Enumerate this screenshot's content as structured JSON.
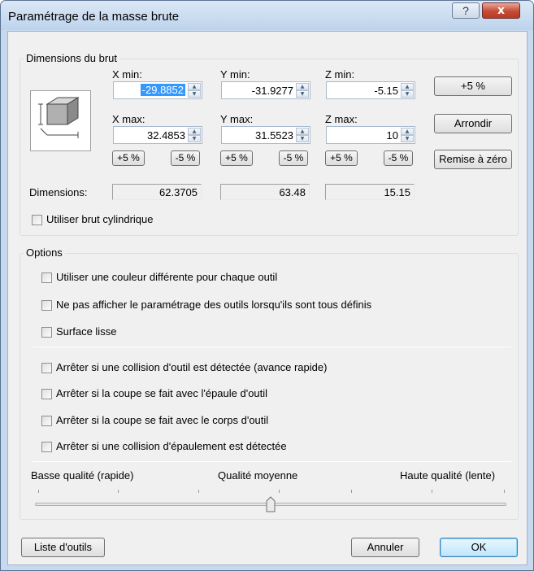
{
  "window": {
    "title": "Paramétrage de la masse brute",
    "help_glyph": "?",
    "close_glyph": "x"
  },
  "dimensions_group": {
    "legend": "Dimensions du brut",
    "x_min_label": "X min:",
    "y_min_label": "Y min:",
    "z_min_label": "Z min:",
    "x_max_label": "X max:",
    "y_max_label": "Y max:",
    "z_max_label": "Z max:",
    "x_min": "-29.8852",
    "y_min": "-31.9277",
    "z_min": "-5.15",
    "x_max": "32.4853",
    "y_max": "31.5523",
    "z_max": "10",
    "plus5": "+5 %",
    "minus5": "-5 %",
    "dimensions_label": "Dimensions:",
    "dim_x": "62.3705",
    "dim_y": "63.48",
    "dim_z": "15.15",
    "cylinder_label": "Utiliser brut cylindrique",
    "cylinder_checked": false,
    "btn_plus5": "+5 %",
    "btn_round": "Arrondir",
    "btn_reset": "Remise à zéro"
  },
  "options_group": {
    "legend": "Options",
    "items": [
      {
        "label": "Utiliser une couleur différente pour chaque outil",
        "checked": false
      },
      {
        "label": "Ne pas afficher le paramétrage des outils lorsqu'ils sont tous définis",
        "checked": false
      },
      {
        "label": "Surface lisse",
        "checked": false
      },
      {
        "label": "Arrêter si une collision d'outil est détectée (avance rapide)",
        "checked": false
      },
      {
        "label": "Arrêter si la coupe se fait avec l'épaule d'outil",
        "checked": false
      },
      {
        "label": "Arrêter si la coupe se fait avec le corps d'outil",
        "checked": false
      },
      {
        "label": "Arrêter si une collision d'épaulement est détectée",
        "checked": false
      }
    ],
    "quality_low": "Basse qualité (rapide)",
    "quality_mid": "Qualité moyenne",
    "quality_high": "Haute qualité (lente)",
    "quality_level": 0.5
  },
  "footer": {
    "tool_list": "Liste d'outils",
    "cancel": "Annuler",
    "ok": "OK"
  },
  "colors": {
    "selection": "#3399ff",
    "default_button_border": "#3c7fb1",
    "close_button": "#c64a35"
  }
}
